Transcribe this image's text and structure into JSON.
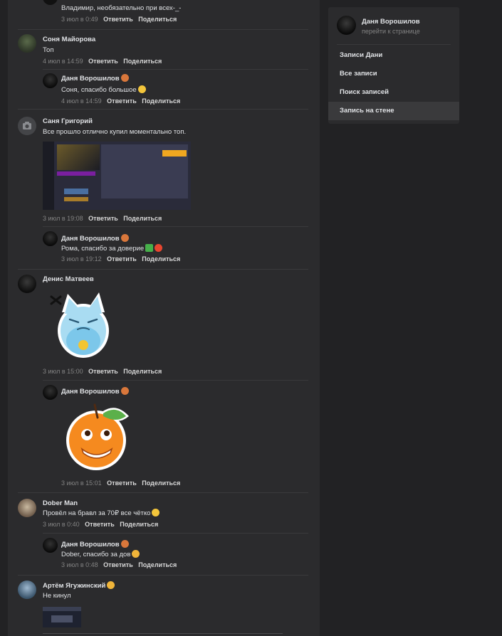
{
  "comments": [
    {
      "author": "",
      "text": "Владимир, необязательно при всех-_-",
      "date": "3 июл в 0:49"
    },
    {
      "author": "Соня Майорова",
      "text": "Топ",
      "date": "4 июл в 14:59"
    },
    {
      "author": "Даня Ворошилов",
      "text": "Соня, спасибо большое",
      "date": "4 июл в 14:59"
    },
    {
      "author": "Саня Григорий",
      "text": "Все прошло отлично купил моментально топ.",
      "date": "3 июл в 19:08"
    },
    {
      "author": "Даня Ворошилов",
      "text": "Рома, спасибо за доверие",
      "date": "3 июл в 19:12"
    },
    {
      "author": "Денис Матвеев",
      "text": "",
      "date": "3 июл в 15:00"
    },
    {
      "author": "Даня Ворошилов",
      "text": "",
      "date": "3 июл в 15:01"
    },
    {
      "author": "Dober Man",
      "text": "Провёл на бравл за 70₽ все чётко",
      "date": "3 июл в 0:40"
    },
    {
      "author": "Даня Ворошилов",
      "text": "Dober, спасибо за дов",
      "date": "3 июл в 0:48"
    },
    {
      "author": "Артём Ягужинский",
      "text": "Не кинул",
      "date": ""
    }
  ],
  "actions": {
    "reply": "Ответить",
    "share": "Поделиться"
  },
  "sidebar": {
    "profile_name": "Даня Ворошилов",
    "profile_link": "перейти к странице",
    "items": [
      "Записи Дани",
      "Все записи",
      "Поиск записей",
      "Запись на стене"
    ]
  },
  "icons": {
    "camera": "camera-icon",
    "sticker_cat": "cat-sticker",
    "sticker_orange": "orange-sticker"
  },
  "colors": {
    "background": "#222224",
    "panel": "#2b2b2d",
    "muted": "#828282",
    "accent": "#5181b8"
  }
}
